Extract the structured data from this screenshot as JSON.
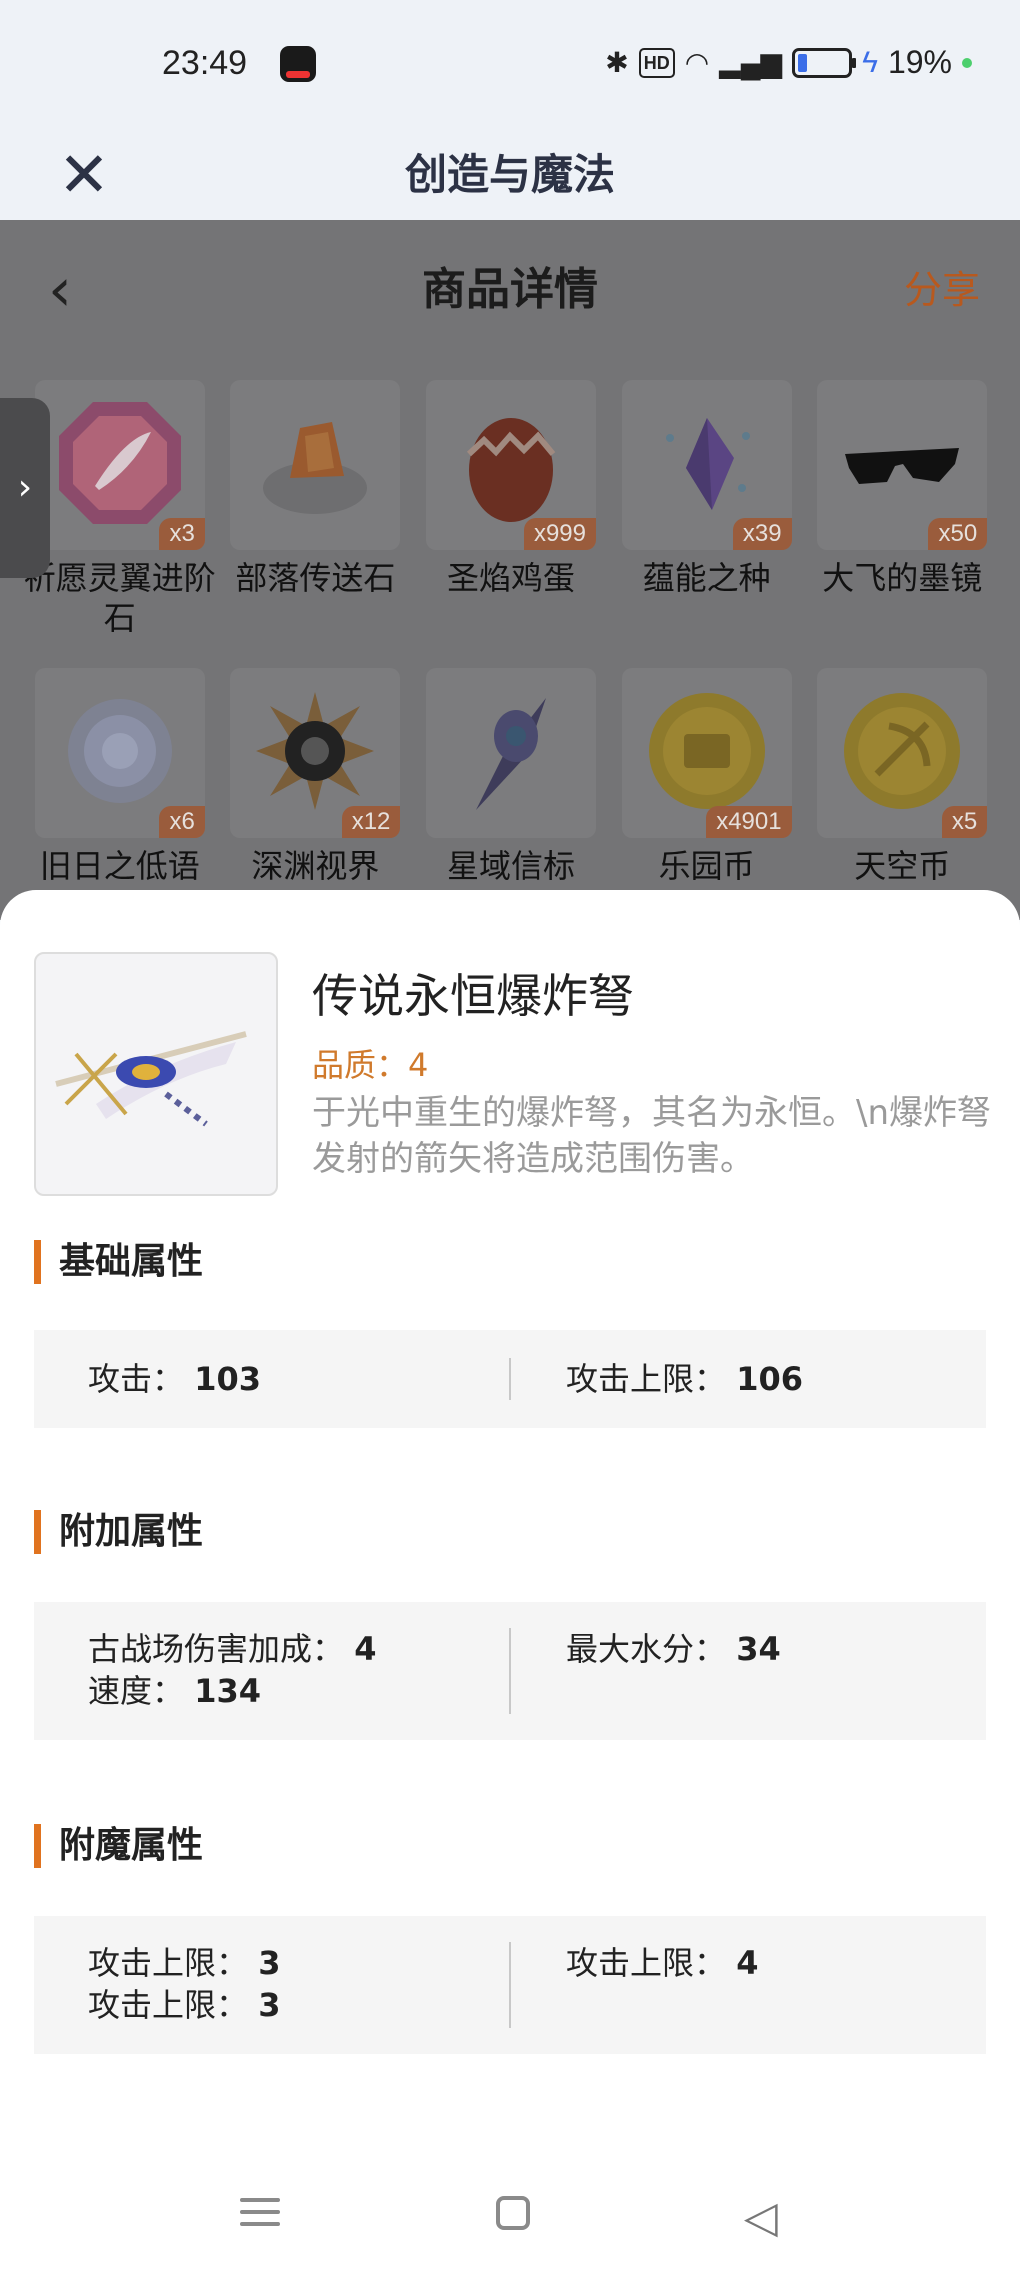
{
  "status_bar": {
    "time": "23:49",
    "battery": "19%",
    "icons": [
      "tiktok-icon",
      "bluetooth-icon",
      "hd-icon",
      "wifi-icon",
      "5g-signal-icon",
      "battery-icon",
      "charging-icon",
      "dot-icon"
    ],
    "hd_label": "HD"
  },
  "header": {
    "title": "创造与魔法"
  },
  "detail_page": {
    "title": "商品详情",
    "share": "分享",
    "items": [
      {
        "name": "祈愿灵翼进阶石",
        "qty": "x3"
      },
      {
        "name": "部落传送石",
        "qty": ""
      },
      {
        "name": "圣焰鸡蛋",
        "qty": "x999"
      },
      {
        "name": "蕴能之种",
        "qty": "x39"
      },
      {
        "name": "大飞的墨镜",
        "qty": "x50"
      },
      {
        "name": "旧日之低语",
        "qty": "x6"
      },
      {
        "name": "深渊视界",
        "qty": "x12"
      },
      {
        "name": "星域信标",
        "qty": ""
      },
      {
        "name": "乐园币",
        "qty": "x4901"
      },
      {
        "name": "天空币",
        "qty": "x5"
      }
    ]
  },
  "sheet": {
    "item_name": "传说永恒爆炸弩",
    "quality": "品质：4",
    "description": "于光中重生的爆炸弩，其名为永恒。\\n爆炸弩发射的箭矢将造成范围伤害。",
    "sections": {
      "basic": {
        "title": "基础属性",
        "left": [
          {
            "label": "攻击：",
            "value": "103"
          }
        ],
        "right": [
          {
            "label": "攻击上限：",
            "value": "106"
          }
        ]
      },
      "extra": {
        "title": "附加属性",
        "left": [
          {
            "label": "古战场伤害加成：",
            "value": "4"
          },
          {
            "label": "速度：",
            "value": "134"
          }
        ],
        "right": [
          {
            "label": "最大水分：",
            "value": "34"
          }
        ]
      },
      "enchant": {
        "title": "附魔属性",
        "left": [
          {
            "label": "攻击上限：",
            "value": "3"
          },
          {
            "label": "攻击上限：",
            "value": "3"
          }
        ],
        "right": [
          {
            "label": "攻击上限：",
            "value": "4"
          }
        ]
      }
    }
  }
}
